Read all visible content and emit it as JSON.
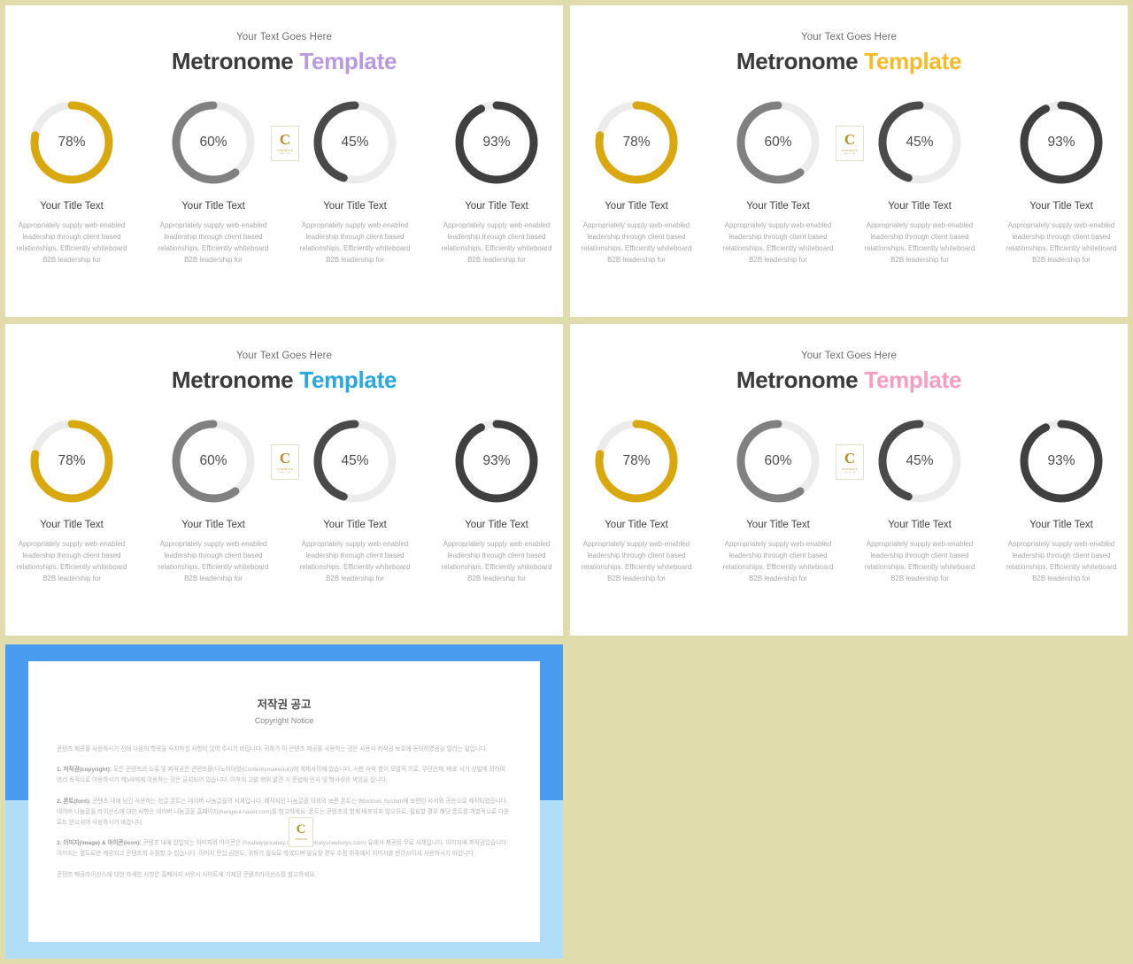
{
  "background_color": "#e0dcac",
  "slides": [
    {
      "id": "slide-1",
      "eyebrow": "Your Text Goes Here",
      "title_dark": "Metronome",
      "title_accent": "Template",
      "accent_color": "#b79ae0"
    },
    {
      "id": "slide-2",
      "eyebrow": "Your Text Goes Here",
      "title_dark": "Metronome",
      "title_accent": "Template",
      "accent_color": "#f5bb27"
    },
    {
      "id": "slide-3",
      "eyebrow": "Your Text Goes Here",
      "title_dark": "Metronome",
      "title_accent": "Template",
      "accent_color": "#29a8e0"
    },
    {
      "id": "slide-4",
      "eyebrow": "Your Text Goes Here",
      "title_dark": "Metronome",
      "title_accent": "Template",
      "accent_color": "#f79ec0"
    }
  ],
  "chart_data": {
    "type": "pie",
    "title": "Metronome Template",
    "legend": "none",
    "categories": [
      "Your Title Text",
      "Your Title Text",
      "Your Title Text",
      "Your Title Text"
    ],
    "values": [
      78,
      60,
      45,
      93
    ],
    "labels": [
      "78%",
      "60%",
      "45%",
      "93%"
    ],
    "units": "percent",
    "ylim": [
      0,
      100
    ],
    "track_color": "#ececed",
    "series": [
      {
        "name": "Your Title Text",
        "value": 78,
        "label": "78%",
        "color": "#d9a80c",
        "direction": "clockwise",
        "body": "Appropriately supply web-enabled leadership through client based relationships. Efficiently whiteboard B2B leadership for"
      },
      {
        "name": "Your Title Text",
        "value": 60,
        "label": "60%",
        "color": "#808080",
        "direction": "counter-clockwise",
        "body": "Appropriately supply web-enabled leadership through client based relationships. Efficiently whiteboard B2B leadership for"
      },
      {
        "name": "Your Title Text",
        "value": 45,
        "label": "45%",
        "color": "#4a4a4a",
        "direction": "counter-clockwise",
        "body": "Appropriately supply web-enabled leadership through client based relationships. Efficiently whiteboard B2B leadership for"
      },
      {
        "name": "Your Title Text",
        "value": 93,
        "label": "93%",
        "color": "#3f3f3f",
        "direction": "clockwise",
        "body": "Appropriately supply web-enabled leadership through client based relationships. Efficiently whiteboard B2B leadership for"
      }
    ]
  },
  "logo": {
    "mark": "C",
    "mark_sub": "CONTENTS",
    "mark_sub2": "MALL  COM"
  },
  "copyright_slide": {
    "title": "저작권 공고",
    "subtitle": "Copyright Notice",
    "intro": "콘텐츠 제공물 사용하시기 전에 다음의 항목을 숙지하실 사항이 있어 주시기 바랍니다. 귀하가 이 콘텐츠 제공물 사용하는 것은 사용시 저작권 보호에 동의하였음을 알리는 말입니다.",
    "sections": [
      {
        "heading": "1. 저작권(copyright):",
        "text": "모든 콘텐츠의 소유 및 저작권은 콘텐츠몰(나노아이엇(Contentsmakeout))에 게재사이에 있습니다. 시판 숙박 함이 모발적 이로, 무단전재, 배포 시가 상발에 의하여 영리 목적으로 이용하시기 제3사에게 이용하는 것은 금지되어 있습니다. 이후의 고발 행위 발견 시 준법에 민사 및 형사상의 책임을 집니다."
      },
      {
        "heading": "2. 폰트(font):",
        "text": "콘텐츠 내에 담긴 사용하는 한글 폰트는 네이버 나눔글꼴의 서체입니다. 제작자인 나눔글꼴 이외의 보편 폰트는 Windows System에 보편된 사서와 공용으로 제작되었습니다. 네이버 나눔글꼴 라이선스에 대한 사항은 네이버 나눔글꼴 홈페이지(hangeul.naver.com)를 참고하세요. 폰트는 콘텐츠의 함께 배포되지 않으므로, 필요할 경우 해당 폰트를 개별적으로 다운로드 받으셔야 사용하시기 바랍니다."
      },
      {
        "heading": "3. 이미지(image) & 아이콘(icon):",
        "text": "콘텐츠 내에 삽입되는 이미지와 아이콘은 Pixabay(pixabay.com)와 Webolys(webolys.com) 유에서 제공된 무료 서체입니다. 이미지에 저작권있습니다. 이미지는 별도로만 제공되고 콘텐츠의 수정할 수 있습니다. 이미지 편집 권한도, 귀하가 필요로 하였으며 필요할 경우 수정 위주에서 이미지를 반려사이셔 사용하시기 바랍니다."
      }
    ],
    "footer": "콘텐츠 제공라이선스에 대한 자세한 사항은 홈페이지 사용시 사이트에 기재된 콘텐츠라이선스를 참고하세요."
  }
}
